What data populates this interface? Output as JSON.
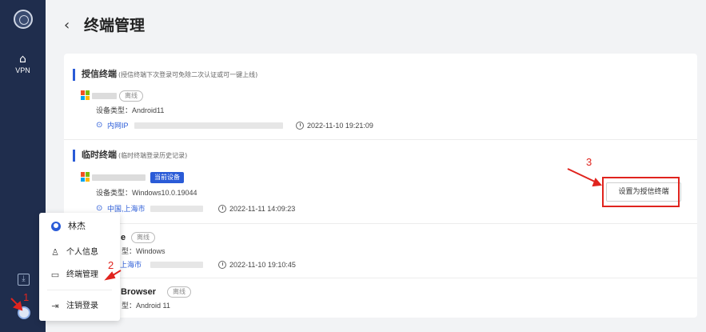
{
  "sidebar": {
    "vpn_label": "VPN",
    "home_glyph": "⌂",
    "download_glyph": "⤓"
  },
  "header": {
    "back_glyph": "‹",
    "title": "终端管理"
  },
  "trusted_section": {
    "title": "授信终端",
    "hint": "(授信终端下次登录可免除二次认证或可一键上线)",
    "devices": [
      {
        "status": "离线",
        "type": "设备类型：Android11",
        "location": "内网IP",
        "time": "2022-11-10 19:21:09"
      }
    ]
  },
  "temp_section": {
    "title": "临时终端",
    "hint": "(临时终端登录历史记录)",
    "devices": [
      {
        "badge": "当前设备",
        "type": "设备类型：Windows10.0.19044",
        "location": "中国,上海市",
        "time": "2022-11-11 14:09:23",
        "action": "设置为授信终端"
      },
      {
        "name_fragment": "e",
        "status": "离线",
        "type_fragment": "型：Windows",
        "location_fragment": "上海市",
        "time": "2022-11-10 19:10:45"
      },
      {
        "name_fragment": "Browser",
        "status": "离线",
        "type_fragment": "型：Android 11"
      }
    ]
  },
  "user_menu": {
    "user_name": "林杰",
    "items": [
      {
        "label": "个人信息",
        "icon": "person-card-icon"
      },
      {
        "label": "终端管理",
        "icon": "terminal-icon"
      },
      {
        "label": "注销登录",
        "icon": "logout-icon"
      }
    ]
  },
  "annotations": {
    "step1": "1",
    "step2": "2",
    "step3": "3"
  },
  "colors": {
    "sidebar": "#1f2d4d",
    "accent": "#2a5bd7",
    "annotation": "#e0241e"
  }
}
